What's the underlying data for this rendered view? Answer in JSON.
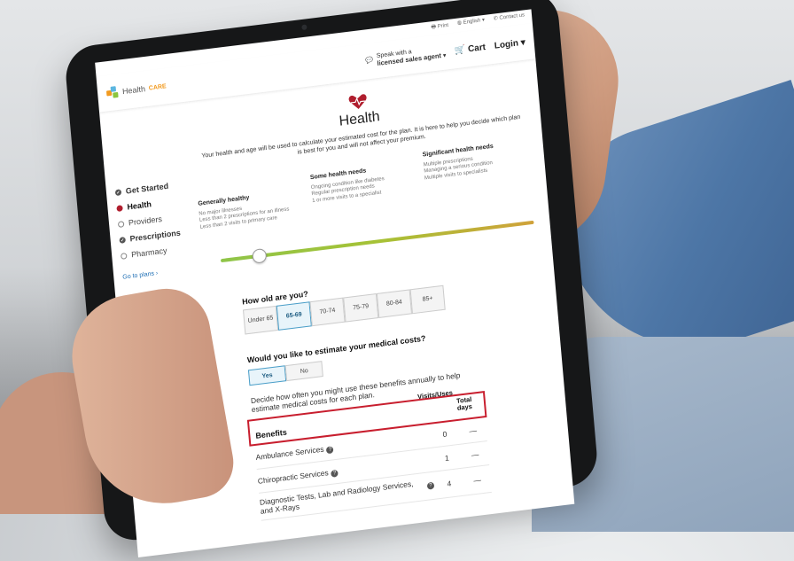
{
  "topbar": {
    "print": "Print",
    "language": "English",
    "contact": "Contact us"
  },
  "header": {
    "logo_main": "Health",
    "logo_accent": "CARE",
    "agent_line1": "Speak with a",
    "agent_line2": "licensed sales agent",
    "cart": "Cart",
    "login": "Login"
  },
  "sidebar": {
    "items": [
      {
        "label": "Get Started",
        "state": "done"
      },
      {
        "label": "Health",
        "state": "active"
      },
      {
        "label": "Providers",
        "state": "todo"
      },
      {
        "label": "Prescriptions",
        "state": "done"
      },
      {
        "label": "Pharmacy",
        "state": "todo"
      }
    ],
    "goto": "Go to plans ›"
  },
  "page": {
    "title": "Health",
    "intro": "Your health and age will be used to calculate your estimated cost for the plan. It is here to help you decide which plan is best for you and will not affect your premium."
  },
  "levels": [
    {
      "heading": "Generally healthy",
      "text": "No major illnesses\nLess than 2 prescriptions for an illness\nLess than 2 visits to primary care"
    },
    {
      "heading": "Some health needs",
      "text": "Ongoing condition like diabetes\nRegular prescription needs\n1 or more visits to a specialist"
    },
    {
      "heading": "Significant health needs",
      "text": "Multiple prescriptions\nManaging a serious condition\nMultiple visits to specialists"
    }
  ],
  "age": {
    "question": "How old are you?",
    "options": [
      "Under 65",
      "65-69",
      "70-74",
      "75-79",
      "80-84",
      "85+"
    ],
    "selected": "65-69"
  },
  "estimate": {
    "question": "Would you like to estimate your medical costs?",
    "yes": "Yes",
    "no": "No",
    "selected": "Yes",
    "description": "Decide how often you might use these benefits annually to help estimate medical costs for each plan."
  },
  "benefits": {
    "header": {
      "benefit": "Benefits",
      "visits": "Visits/Uses",
      "days": "Total days"
    },
    "rows": [
      {
        "name": "Ambulance Services",
        "visits": "0",
        "days": "—"
      },
      {
        "name": "Chiropractic Services",
        "visits": "1",
        "days": "—"
      },
      {
        "name": "Diagnostic Tests, Lab and Radiology Services, and X-Rays",
        "visits": "4",
        "days": "—"
      }
    ]
  }
}
